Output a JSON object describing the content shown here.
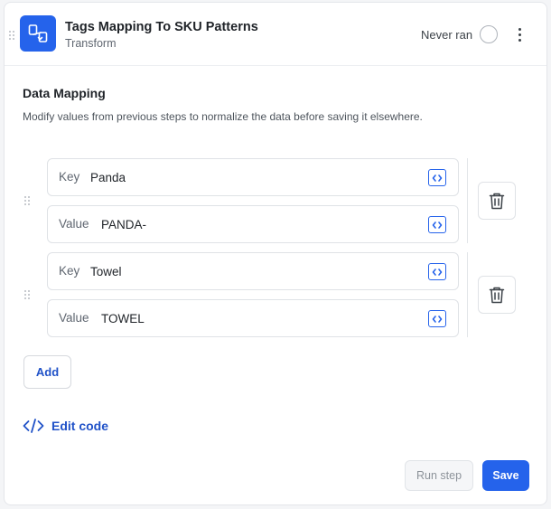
{
  "header": {
    "title": "Tags Mapping To SKU Patterns",
    "subtitle": "Transform",
    "status": "Never ran",
    "icon": "transform-icon"
  },
  "section": {
    "title": "Data Mapping",
    "description": "Modify values from previous steps to normalize the data before saving it elsewhere."
  },
  "mappings": [
    {
      "key_label": "Key",
      "key": "Panda",
      "value_label": "Value",
      "value": "PANDA-"
    },
    {
      "key_label": "Key",
      "key": "Towel",
      "value_label": "Value",
      "value": "TOWEL"
    }
  ],
  "actions": {
    "add": "Add",
    "edit_code": "Edit code",
    "run_step": "Run step",
    "save": "Save"
  },
  "colors": {
    "accent": "#2563eb",
    "link": "#2052c8"
  }
}
